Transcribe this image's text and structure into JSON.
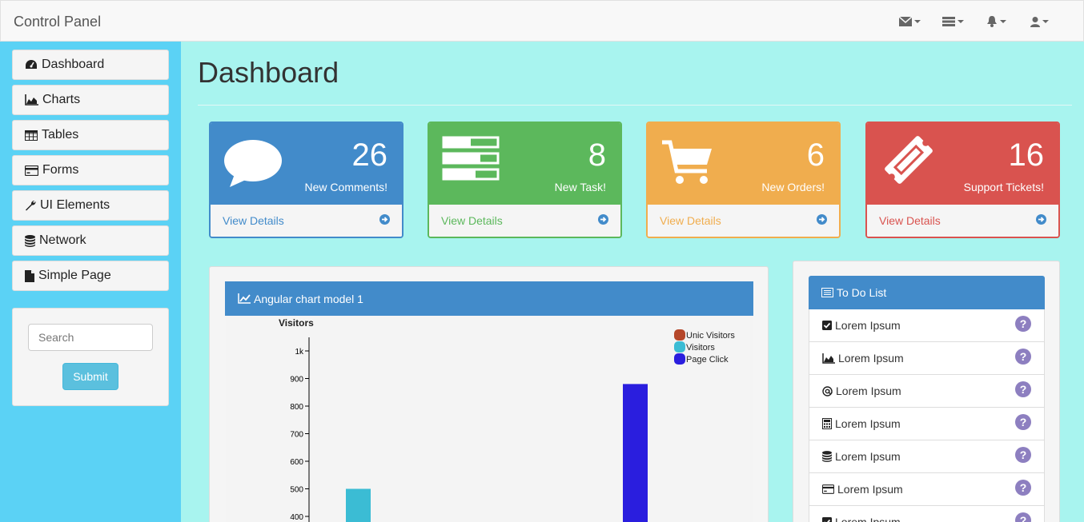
{
  "navbar": {
    "brand": "Control Panel",
    "icons": [
      "envelope-icon",
      "tasks-icon",
      "bell-icon",
      "user-icon"
    ]
  },
  "sidebar": {
    "items": [
      {
        "label": "Dashboard",
        "icon": "dashboard-icon"
      },
      {
        "label": "Charts",
        "icon": "area-chart-icon"
      },
      {
        "label": "Tables",
        "icon": "table-icon"
      },
      {
        "label": "Forms",
        "icon": "credit-card-icon"
      },
      {
        "label": "UI Elements",
        "icon": "wrench-icon"
      },
      {
        "label": "Network",
        "icon": "database-icon"
      },
      {
        "label": "Simple Page",
        "icon": "file-icon"
      }
    ],
    "search_placeholder": "Search",
    "submit_label": "Submit"
  },
  "main": {
    "title": "Dashboard"
  },
  "panels": [
    {
      "count": "26",
      "label": "New Comments!",
      "footer": "View Details",
      "color": "#428bca",
      "icon": "comment-icon"
    },
    {
      "count": "8",
      "label": "New Task!",
      "footer": "View Details",
      "color": "#5cb85c",
      "icon": "tasks-icon"
    },
    {
      "count": "6",
      "label": "New Orders!",
      "footer": "View Details",
      "color": "#f0ad4e",
      "icon": "shopping-cart-icon"
    },
    {
      "count": "16",
      "label": "Support Tickets!",
      "footer": "View Details",
      "color": "#d9534f",
      "icon": "ticket-icon"
    }
  ],
  "chart_panel": {
    "title": "Angular chart model 1"
  },
  "chart_data": {
    "type": "bar",
    "title": "",
    "ylabel": "Visitors",
    "ylim": [
      300,
      1000
    ],
    "yticks": [
      "400",
      "500",
      "600",
      "700",
      "800",
      "900",
      "1k"
    ],
    "series": [
      {
        "name": "Unic Visitors",
        "color": "#b5472a",
        "values": []
      },
      {
        "name": "Visitors",
        "color": "#3bbcd4",
        "values": [
          500
        ]
      },
      {
        "name": "Page Click",
        "color": "#2a1ede",
        "values": [
          880
        ]
      }
    ],
    "legend_position": "top-right",
    "grid": false
  },
  "todo": {
    "title": "To Do List",
    "items": [
      {
        "label": "Lorem Ipsum",
        "icon": "check-square-icon"
      },
      {
        "label": "Lorem Ipsum",
        "icon": "area-chart-icon"
      },
      {
        "label": "Lorem Ipsum",
        "icon": "at-icon"
      },
      {
        "label": "Lorem Ipsum",
        "icon": "calculator-icon"
      },
      {
        "label": "Lorem Ipsum",
        "icon": "database-icon"
      },
      {
        "label": "Lorem Ipsum",
        "icon": "credit-card-icon"
      },
      {
        "label": "Lorem Ipsum",
        "icon": "check-square-icon"
      }
    ],
    "help_glyph": "?"
  }
}
